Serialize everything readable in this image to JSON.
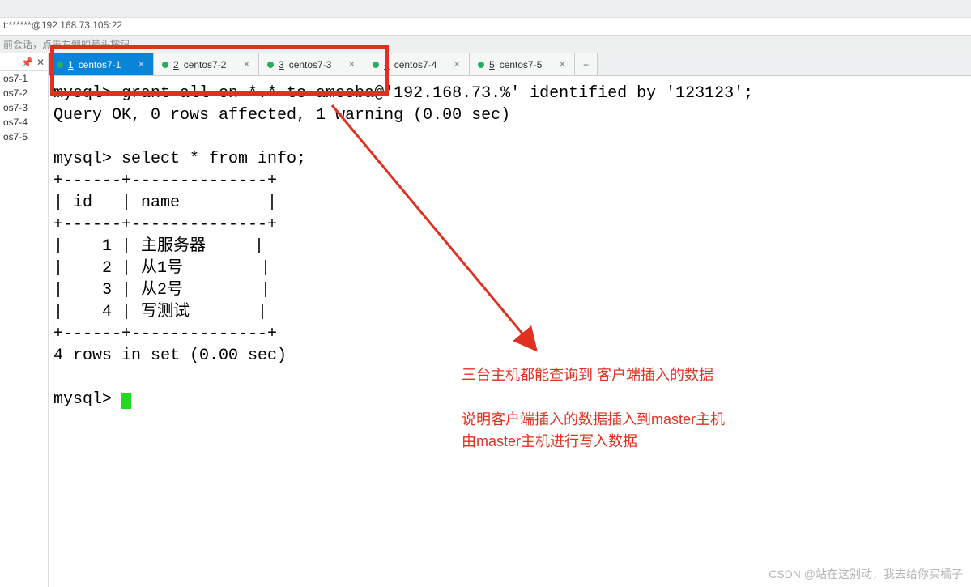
{
  "address": "t:******@192.168.73.105:22",
  "session_hint": "前会话，点击左侧的箭头按钮。",
  "sidebar": {
    "items": [
      {
        "label": "os7-1"
      },
      {
        "label": "os7-2"
      },
      {
        "label": "os7-3"
      },
      {
        "label": "os7-4"
      },
      {
        "label": "os7-5"
      }
    ]
  },
  "tabs": [
    {
      "num": "1",
      "label": "centos7-1",
      "active": true
    },
    {
      "num": "2",
      "label": "centos7-2",
      "active": false
    },
    {
      "num": "3",
      "label": "centos7-3",
      "active": false
    },
    {
      "num": "4",
      "label": "centos7-4",
      "active": false
    },
    {
      "num": "5",
      "label": "centos7-5",
      "active": false
    }
  ],
  "tab_add": "+",
  "terminal_lines": [
    "mysql> grant all on *.* to amoeba@'192.168.73.%' identified by '123123';",
    "Query OK, 0 rows affected, 1 warning (0.00 sec)",
    "",
    "mysql> select * from info;",
    "+------+--------------+",
    "| id   | name         |",
    "+------+--------------+",
    "|    1 | 主服务器     |",
    "|    2 | 从1号        |",
    "|    3 | 从2号        |",
    "|    4 | 写测试       |",
    "+------+--------------+",
    "4 rows in set (0.00 sec)",
    "",
    "mysql> "
  ],
  "annotations": {
    "line1": "三台主机都能查询到  客户端插入的数据",
    "line2": "说明客户端插入的数据插入到master主机",
    "line3": "由master主机进行写入数据"
  },
  "watermark": "CSDN @站在这别动，我去给你买橘子",
  "icons": {
    "pin": "📌",
    "close": "✕"
  }
}
